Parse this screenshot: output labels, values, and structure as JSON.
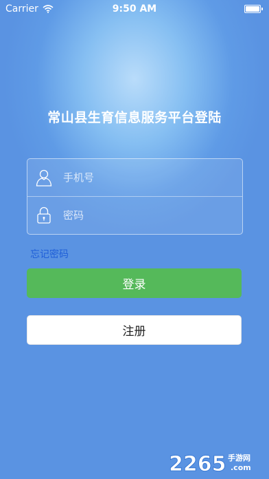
{
  "status_bar": {
    "carrier": "Carrier",
    "time": "9:50 AM"
  },
  "page": {
    "title": "常山县生育信息服务平台登陆"
  },
  "form": {
    "phone_placeholder": "手机号",
    "password_placeholder": "密码",
    "forgot_label": "忘记密码"
  },
  "buttons": {
    "login_label": "登录",
    "register_label": "注册"
  },
  "watermark": {
    "number": "2265",
    "suffix": "手游网",
    "domain": ".com"
  },
  "colors": {
    "background": "#5f9be6",
    "login_button": "#55b95a",
    "forgot_link": "#1f5fd8",
    "register_button": "#ffffff"
  },
  "icons": [
    "wifi-icon",
    "battery-icon",
    "user-icon",
    "lock-icon"
  ]
}
